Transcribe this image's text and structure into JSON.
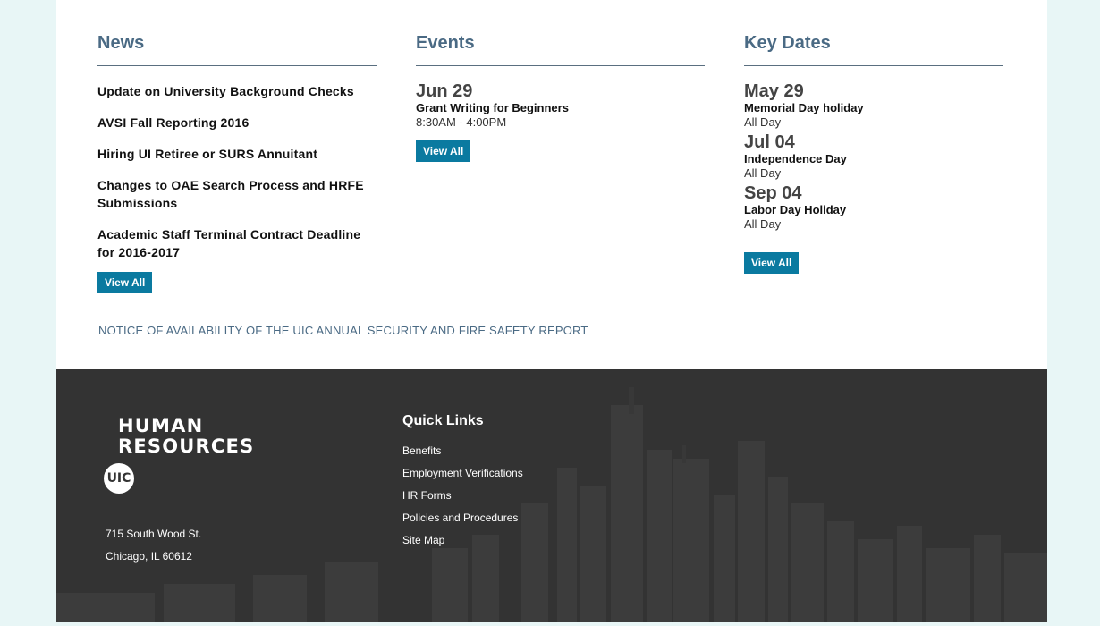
{
  "news": {
    "heading": "News",
    "items": [
      "Update on University Background Checks",
      "AVSI Fall Reporting 2016",
      "Hiring UI Retiree or SURS Annuitant",
      "Changes to OAE Search Process and HRFE Submissions",
      "Academic Staff Terminal Contract Deadline for 2016-2017"
    ],
    "view_all": "View All"
  },
  "events": {
    "heading": "Events",
    "items": [
      {
        "date": "Jun 29",
        "title": "Grant Writing for Beginners",
        "time": "8:30AM - 4:00PM"
      }
    ],
    "view_all": "View All"
  },
  "key_dates": {
    "heading": "Key Dates",
    "items": [
      {
        "date": "May 29",
        "title": "Memorial Day holiday",
        "sub": "All Day"
      },
      {
        "date": "Jul 04",
        "title": "Independence Day",
        "sub": "All Day"
      },
      {
        "date": "Sep 04",
        "title": "Labor Day Holiday",
        "sub": "All Day"
      }
    ],
    "view_all": "View All"
  },
  "notice": "NOTICE OF AVAILABILITY OF THE UIC ANNUAL SECURITY AND FIRE SAFETY REPORT",
  "footer": {
    "logo_line1": "HUMAN",
    "logo_line2": "RESOURCES",
    "badge": "UIC",
    "address1": "715 South Wood St.",
    "address2": "Chicago, IL 60612",
    "quick_links_heading": "Quick Links",
    "quick_links": [
      "Benefits",
      "Employment Verifications",
      "HR Forms",
      "Policies and Procedures",
      "Site Map"
    ]
  },
  "colors": {
    "accent_button": "#0a7aa0",
    "heading": "#4a6a84",
    "footer_bg": "#333333",
    "outer_bg": "#e8f6f6"
  }
}
